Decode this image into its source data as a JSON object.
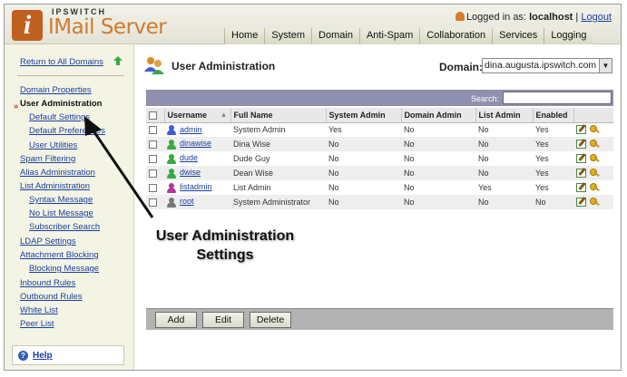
{
  "header": {
    "brand_small": "IPSWITCH",
    "brand_product": "IMail Server",
    "login_prefix": "Logged in as:",
    "login_user": "localhost",
    "logout_label": "Logout"
  },
  "topnav": [
    "Home",
    "System",
    "Domain",
    "Anti-Spam",
    "Collaboration",
    "Services",
    "Logging"
  ],
  "sidebar": {
    "return_link": "Return to All Domains",
    "items": [
      "Domain Properties",
      "User Administration",
      "Default Settings",
      "Default Preferences",
      "User Utilities",
      "Spam Filtering",
      "Alias Administration",
      "List Administration",
      "Syntax Message",
      "No List Message",
      "Subscriber Search",
      "LDAP Settings",
      "Attachment Blocking",
      "Blocking Message",
      "Inbound Rules",
      "Outbound Rules",
      "White List",
      "Peer List"
    ],
    "help_label": "Help"
  },
  "main": {
    "title": "User Administration",
    "domain_label": "Domain:",
    "domain_value": "dina.augusta.ipswitch.com",
    "search_label": "Search:",
    "columns": [
      "Username",
      "Full Name",
      "System Admin",
      "Domain Admin",
      "List Admin",
      "Enabled"
    ],
    "rows": [
      {
        "username": "admin",
        "fullname": "System Admin",
        "system_admin": "Yes",
        "domain_admin": "No",
        "list_admin": "No",
        "enabled": "Yes",
        "icon_color": "#3a5fd0"
      },
      {
        "username": "dinawise",
        "fullname": "Dina Wise",
        "system_admin": "No",
        "domain_admin": "No",
        "list_admin": "No",
        "enabled": "Yes",
        "icon_color": "#3aa845"
      },
      {
        "username": "dude",
        "fullname": "Dude Guy",
        "system_admin": "No",
        "domain_admin": "No",
        "list_admin": "No",
        "enabled": "Yes",
        "icon_color": "#3aa845"
      },
      {
        "username": "dwise",
        "fullname": "Dean Wise",
        "system_admin": "No",
        "domain_admin": "No",
        "list_admin": "No",
        "enabled": "Yes",
        "icon_color": "#3aa845"
      },
      {
        "username": "listadmin",
        "fullname": "List Admin",
        "system_admin": "No",
        "domain_admin": "No",
        "list_admin": "Yes",
        "enabled": "Yes",
        "icon_color": "#b0389a"
      },
      {
        "username": "root",
        "fullname": "System Administrator",
        "system_admin": "No",
        "domain_admin": "No",
        "list_admin": "No",
        "enabled": "No",
        "icon_color": "#777777"
      }
    ],
    "buttons": {
      "add": "Add",
      "edit": "Edit",
      "delete": "Delete"
    }
  },
  "annotation": {
    "line1": "User Administration",
    "line2": "Settings"
  }
}
